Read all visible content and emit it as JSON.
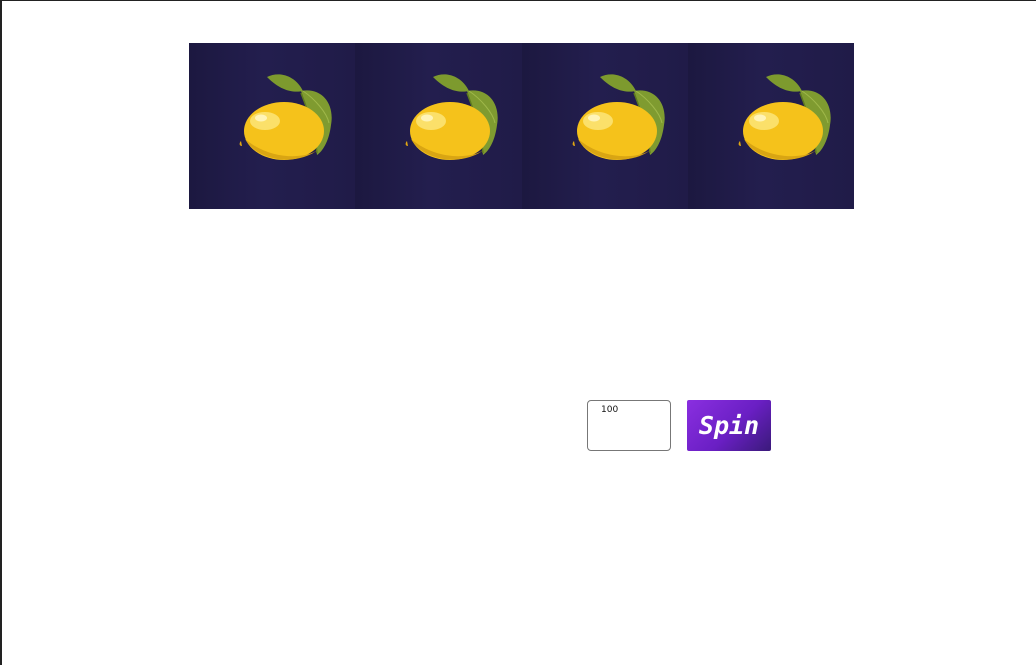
{
  "reels": [
    {
      "symbol": "lemon-icon"
    },
    {
      "symbol": "lemon-icon"
    },
    {
      "symbol": "lemon-icon"
    },
    {
      "symbol": "lemon-icon"
    }
  ],
  "controls": {
    "bet_value": "100",
    "spin_label": "Spin"
  },
  "colors": {
    "reel_background": "#1f1a45",
    "spin_button": "#7a22d6",
    "lemon": "#f5c21b",
    "leaf": "#7d9a2e"
  }
}
